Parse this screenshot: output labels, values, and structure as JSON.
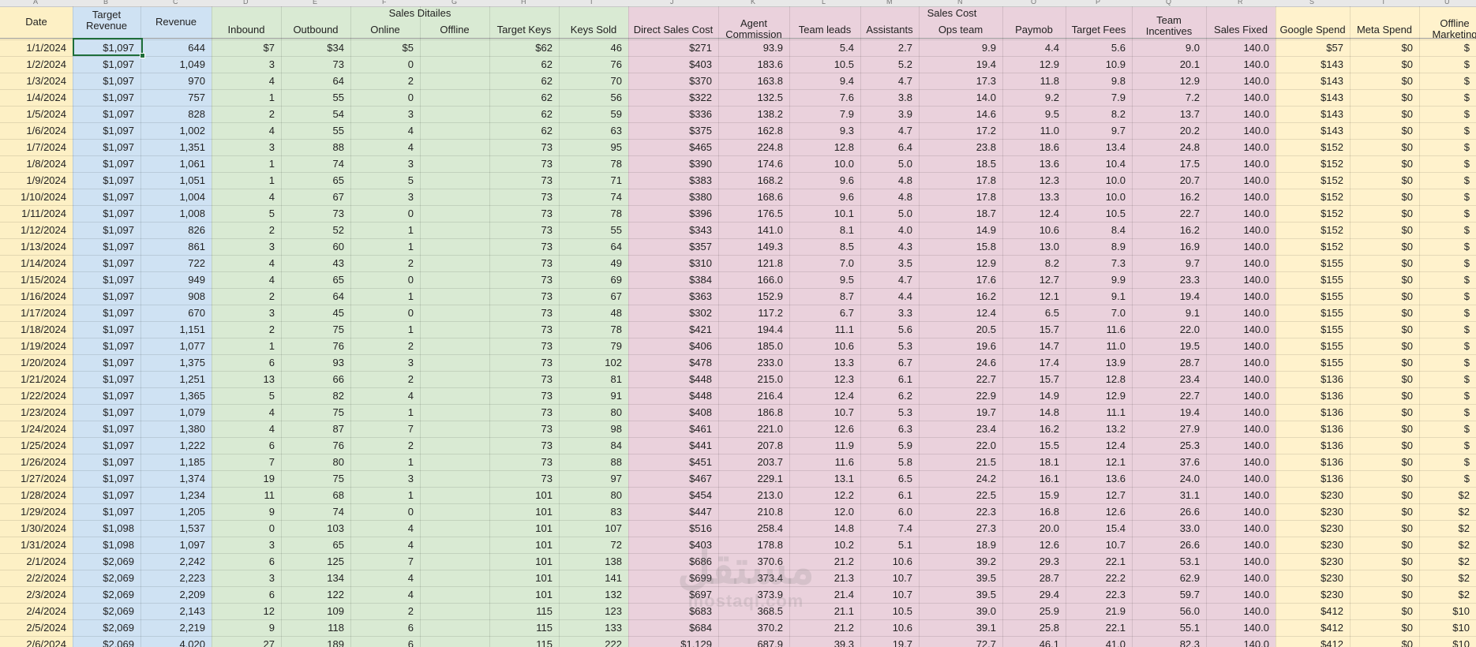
{
  "colors": {
    "date": "#fdf0c5",
    "revenue": "#cfe2f3",
    "sales_details": "#d9ead3",
    "sales_cost": "#ead1dc",
    "marketing": "#fff2cc"
  },
  "column_letters": [
    "A",
    "B",
    "C",
    "D",
    "E",
    "F",
    "G",
    "H",
    "I",
    "J",
    "K",
    "L",
    "M",
    "N",
    "O",
    "P",
    "Q",
    "R",
    "S",
    "T",
    "U"
  ],
  "group_headers": {
    "sales_details": "Sales Ditailes",
    "sales_cost": "Sales Cost"
  },
  "headers": {
    "date": "Date",
    "target_revenue_1": "Target",
    "target_revenue_2": "Revenue",
    "revenue": "Revenue",
    "inbound": "Inbound",
    "outbound": "Outbound",
    "online": "Online",
    "offline": "Offline",
    "target_keys": "Target Keys",
    "keys_sold": "Keys Sold",
    "direct_sales_cost": "Direct Sales Cost",
    "agent_commission_1": "Agent",
    "agent_commission_2": "Commission",
    "team_leads": "Team leads",
    "assistants": "Assistants",
    "ops_team": "Ops team",
    "paymob": "Paymob",
    "target_fees": "Target Fees",
    "team_incentives_1": "Team",
    "team_incentives_2": "Incentives",
    "sales_fixed": "Sales Fixed",
    "google_spend": "Google Spend",
    "meta_spend": "Meta Spend",
    "offline_marketing_1": "Offline",
    "offline_marketing_2": "Marketing"
  },
  "rows": [
    [
      "1/1/2024",
      "$1,097",
      "644",
      "$7",
      "$34",
      "$5",
      "",
      "$62",
      "46",
      "$271",
      "93.9",
      "5.4",
      "2.7",
      "9.9",
      "4.4",
      "5.6",
      "9.0",
      "140.0",
      "$57",
      "$0",
      "$"
    ],
    [
      "1/2/2024",
      "$1,097",
      "1,049",
      "3",
      "73",
      "0",
      "",
      "62",
      "76",
      "$403",
      "183.6",
      "10.5",
      "5.2",
      "19.4",
      "12.9",
      "10.9",
      "20.1",
      "140.0",
      "$143",
      "$0",
      "$"
    ],
    [
      "1/3/2024",
      "$1,097",
      "970",
      "4",
      "64",
      "2",
      "",
      "62",
      "70",
      "$370",
      "163.8",
      "9.4",
      "4.7",
      "17.3",
      "11.8",
      "9.8",
      "12.9",
      "140.0",
      "$143",
      "$0",
      "$"
    ],
    [
      "1/4/2024",
      "$1,097",
      "757",
      "1",
      "55",
      "0",
      "",
      "62",
      "56",
      "$322",
      "132.5",
      "7.6",
      "3.8",
      "14.0",
      "9.2",
      "7.9",
      "7.2",
      "140.0",
      "$143",
      "$0",
      "$"
    ],
    [
      "1/5/2024",
      "$1,097",
      "828",
      "2",
      "54",
      "3",
      "",
      "62",
      "59",
      "$336",
      "138.2",
      "7.9",
      "3.9",
      "14.6",
      "9.5",
      "8.2",
      "13.7",
      "140.0",
      "$143",
      "$0",
      "$"
    ],
    [
      "1/6/2024",
      "$1,097",
      "1,002",
      "4",
      "55",
      "4",
      "",
      "62",
      "63",
      "$375",
      "162.8",
      "9.3",
      "4.7",
      "17.2",
      "11.0",
      "9.7",
      "20.2",
      "140.0",
      "$143",
      "$0",
      "$"
    ],
    [
      "1/7/2024",
      "$1,097",
      "1,351",
      "3",
      "88",
      "4",
      "",
      "73",
      "95",
      "$465",
      "224.8",
      "12.8",
      "6.4",
      "23.8",
      "18.6",
      "13.4",
      "24.8",
      "140.0",
      "$152",
      "$0",
      "$"
    ],
    [
      "1/8/2024",
      "$1,097",
      "1,061",
      "1",
      "74",
      "3",
      "",
      "73",
      "78",
      "$390",
      "174.6",
      "10.0",
      "5.0",
      "18.5",
      "13.6",
      "10.4",
      "17.5",
      "140.0",
      "$152",
      "$0",
      "$"
    ],
    [
      "1/9/2024",
      "$1,097",
      "1,051",
      "1",
      "65",
      "5",
      "",
      "73",
      "71",
      "$383",
      "168.2",
      "9.6",
      "4.8",
      "17.8",
      "12.3",
      "10.0",
      "20.7",
      "140.0",
      "$152",
      "$0",
      "$"
    ],
    [
      "1/10/2024",
      "$1,097",
      "1,004",
      "4",
      "67",
      "3",
      "",
      "73",
      "74",
      "$380",
      "168.6",
      "9.6",
      "4.8",
      "17.8",
      "13.3",
      "10.0",
      "16.2",
      "140.0",
      "$152",
      "$0",
      "$"
    ],
    [
      "1/11/2024",
      "$1,097",
      "1,008",
      "5",
      "73",
      "0",
      "",
      "73",
      "78",
      "$396",
      "176.5",
      "10.1",
      "5.0",
      "18.7",
      "12.4",
      "10.5",
      "22.7",
      "140.0",
      "$152",
      "$0",
      "$"
    ],
    [
      "1/12/2024",
      "$1,097",
      "826",
      "2",
      "52",
      "1",
      "",
      "73",
      "55",
      "$343",
      "141.0",
      "8.1",
      "4.0",
      "14.9",
      "10.6",
      "8.4",
      "16.2",
      "140.0",
      "$152",
      "$0",
      "$"
    ],
    [
      "1/13/2024",
      "$1,097",
      "861",
      "3",
      "60",
      "1",
      "",
      "73",
      "64",
      "$357",
      "149.3",
      "8.5",
      "4.3",
      "15.8",
      "13.0",
      "8.9",
      "16.9",
      "140.0",
      "$152",
      "$0",
      "$"
    ],
    [
      "1/14/2024",
      "$1,097",
      "722",
      "4",
      "43",
      "2",
      "",
      "73",
      "49",
      "$310",
      "121.8",
      "7.0",
      "3.5",
      "12.9",
      "8.2",
      "7.3",
      "9.7",
      "140.0",
      "$155",
      "$0",
      "$"
    ],
    [
      "1/15/2024",
      "$1,097",
      "949",
      "4",
      "65",
      "0",
      "",
      "73",
      "69",
      "$384",
      "166.0",
      "9.5",
      "4.7",
      "17.6",
      "12.7",
      "9.9",
      "23.3",
      "140.0",
      "$155",
      "$0",
      "$"
    ],
    [
      "1/16/2024",
      "$1,097",
      "908",
      "2",
      "64",
      "1",
      "",
      "73",
      "67",
      "$363",
      "152.9",
      "8.7",
      "4.4",
      "16.2",
      "12.1",
      "9.1",
      "19.4",
      "140.0",
      "$155",
      "$0",
      "$"
    ],
    [
      "1/17/2024",
      "$1,097",
      "670",
      "3",
      "45",
      "0",
      "",
      "73",
      "48",
      "$302",
      "117.2",
      "6.7",
      "3.3",
      "12.4",
      "6.5",
      "7.0",
      "9.1",
      "140.0",
      "$155",
      "$0",
      "$"
    ],
    [
      "1/18/2024",
      "$1,097",
      "1,151",
      "2",
      "75",
      "1",
      "",
      "73",
      "78",
      "$421",
      "194.4",
      "11.1",
      "5.6",
      "20.5",
      "15.7",
      "11.6",
      "22.0",
      "140.0",
      "$155",
      "$0",
      "$"
    ],
    [
      "1/19/2024",
      "$1,097",
      "1,077",
      "1",
      "76",
      "2",
      "",
      "73",
      "79",
      "$406",
      "185.0",
      "10.6",
      "5.3",
      "19.6",
      "14.7",
      "11.0",
      "19.5",
      "140.0",
      "$155",
      "$0",
      "$"
    ],
    [
      "1/20/2024",
      "$1,097",
      "1,375",
      "6",
      "93",
      "3",
      "",
      "73",
      "102",
      "$478",
      "233.0",
      "13.3",
      "6.7",
      "24.6",
      "17.4",
      "13.9",
      "28.7",
      "140.0",
      "$155",
      "$0",
      "$"
    ],
    [
      "1/21/2024",
      "$1,097",
      "1,251",
      "13",
      "66",
      "2",
      "",
      "73",
      "81",
      "$448",
      "215.0",
      "12.3",
      "6.1",
      "22.7",
      "15.7",
      "12.8",
      "23.4",
      "140.0",
      "$136",
      "$0",
      "$"
    ],
    [
      "1/22/2024",
      "$1,097",
      "1,365",
      "5",
      "82",
      "4",
      "",
      "73",
      "91",
      "$448",
      "216.4",
      "12.4",
      "6.2",
      "22.9",
      "14.9",
      "12.9",
      "22.7",
      "140.0",
      "$136",
      "$0",
      "$"
    ],
    [
      "1/23/2024",
      "$1,097",
      "1,079",
      "4",
      "75",
      "1",
      "",
      "73",
      "80",
      "$408",
      "186.8",
      "10.7",
      "5.3",
      "19.7",
      "14.8",
      "11.1",
      "19.4",
      "140.0",
      "$136",
      "$0",
      "$"
    ],
    [
      "1/24/2024",
      "$1,097",
      "1,380",
      "4",
      "87",
      "7",
      "",
      "73",
      "98",
      "$461",
      "221.0",
      "12.6",
      "6.3",
      "23.4",
      "16.2",
      "13.2",
      "27.9",
      "140.0",
      "$136",
      "$0",
      "$"
    ],
    [
      "1/25/2024",
      "$1,097",
      "1,222",
      "6",
      "76",
      "2",
      "",
      "73",
      "84",
      "$441",
      "207.8",
      "11.9",
      "5.9",
      "22.0",
      "15.5",
      "12.4",
      "25.3",
      "140.0",
      "$136",
      "$0",
      "$"
    ],
    [
      "1/26/2024",
      "$1,097",
      "1,185",
      "7",
      "80",
      "1",
      "",
      "73",
      "88",
      "$451",
      "203.7",
      "11.6",
      "5.8",
      "21.5",
      "18.1",
      "12.1",
      "37.6",
      "140.0",
      "$136",
      "$0",
      "$"
    ],
    [
      "1/27/2024",
      "$1,097",
      "1,374",
      "19",
      "75",
      "3",
      "",
      "73",
      "97",
      "$467",
      "229.1",
      "13.1",
      "6.5",
      "24.2",
      "16.1",
      "13.6",
      "24.0",
      "140.0",
      "$136",
      "$0",
      "$"
    ],
    [
      "1/28/2024",
      "$1,097",
      "1,234",
      "11",
      "68",
      "1",
      "",
      "101",
      "80",
      "$454",
      "213.0",
      "12.2",
      "6.1",
      "22.5",
      "15.9",
      "12.7",
      "31.1",
      "140.0",
      "$230",
      "$0",
      "$2"
    ],
    [
      "1/29/2024",
      "$1,097",
      "1,205",
      "9",
      "74",
      "0",
      "",
      "101",
      "83",
      "$447",
      "210.8",
      "12.0",
      "6.0",
      "22.3",
      "16.8",
      "12.6",
      "26.6",
      "140.0",
      "$230",
      "$0",
      "$2"
    ],
    [
      "1/30/2024",
      "$1,098",
      "1,537",
      "0",
      "103",
      "4",
      "",
      "101",
      "107",
      "$516",
      "258.4",
      "14.8",
      "7.4",
      "27.3",
      "20.0",
      "15.4",
      "33.0",
      "140.0",
      "$230",
      "$0",
      "$2"
    ],
    [
      "1/31/2024",
      "$1,098",
      "1,097",
      "3",
      "65",
      "4",
      "",
      "101",
      "72",
      "$403",
      "178.8",
      "10.2",
      "5.1",
      "18.9",
      "12.6",
      "10.7",
      "26.6",
      "140.0",
      "$230",
      "$0",
      "$2"
    ],
    [
      "2/1/2024",
      "$2,069",
      "2,242",
      "6",
      "125",
      "7",
      "",
      "101",
      "138",
      "$686",
      "370.6",
      "21.2",
      "10.6",
      "39.2",
      "29.3",
      "22.1",
      "53.1",
      "140.0",
      "$230",
      "$0",
      "$2"
    ],
    [
      "2/2/2024",
      "$2,069",
      "2,223",
      "3",
      "134",
      "4",
      "",
      "101",
      "141",
      "$699",
      "373.4",
      "21.3",
      "10.7",
      "39.5",
      "28.7",
      "22.2",
      "62.9",
      "140.0",
      "$230",
      "$0",
      "$2"
    ],
    [
      "2/3/2024",
      "$2,069",
      "2,209",
      "6",
      "122",
      "4",
      "",
      "101",
      "132",
      "$697",
      "373.9",
      "21.4",
      "10.7",
      "39.5",
      "29.4",
      "22.3",
      "59.7",
      "140.0",
      "$230",
      "$0",
      "$2"
    ],
    [
      "2/4/2024",
      "$2,069",
      "2,143",
      "12",
      "109",
      "2",
      "",
      "115",
      "123",
      "$683",
      "368.5",
      "21.1",
      "10.5",
      "39.0",
      "25.9",
      "21.9",
      "56.0",
      "140.0",
      "$412",
      "$0",
      "$10"
    ],
    [
      "2/5/2024",
      "$2,069",
      "2,219",
      "9",
      "118",
      "6",
      "",
      "115",
      "133",
      "$684",
      "370.2",
      "21.2",
      "10.6",
      "39.1",
      "25.8",
      "22.1",
      "55.1",
      "140.0",
      "$412",
      "$0",
      "$10"
    ],
    [
      "2/6/2024",
      "$2,069",
      "4,020",
      "27",
      "189",
      "6",
      "",
      "115",
      "222",
      "$1,129",
      "687.9",
      "39.3",
      "19.7",
      "72.7",
      "46.1",
      "41.0",
      "82.3",
      "140.0",
      "$412",
      "$0",
      "$10"
    ]
  ],
  "watermark": {
    "arabic": "مستقل",
    "latin": "mostaql.com"
  }
}
